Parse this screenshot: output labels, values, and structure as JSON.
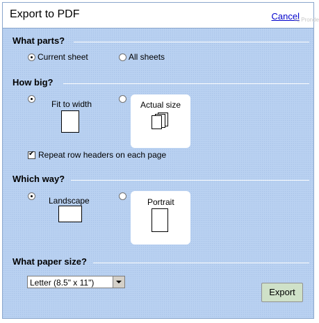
{
  "dialog": {
    "title": "Export to PDF",
    "cancel_label": "Cancel",
    "corner_note": "rq Pronde"
  },
  "parts": {
    "heading": "What parts?",
    "options": [
      "Current sheet",
      "All sheets"
    ],
    "selected": "Current sheet"
  },
  "size": {
    "heading": "How big?",
    "options": [
      "Fit to width",
      "Actual size"
    ],
    "selected": "Fit to width",
    "repeat_headers_label": "Repeat row headers on each page",
    "repeat_headers_checked": true
  },
  "orientation": {
    "heading": "Which way?",
    "options": [
      "Landscape",
      "Portrait"
    ],
    "selected": "Landscape"
  },
  "paper": {
    "heading": "What paper size?",
    "selected_value": "Letter (8.5\" x 11\")"
  },
  "actions": {
    "export_label": "Export"
  },
  "colors": {
    "background": "#b9d1f1",
    "export_button": "#cfe1c8",
    "link": "#0000cc"
  }
}
